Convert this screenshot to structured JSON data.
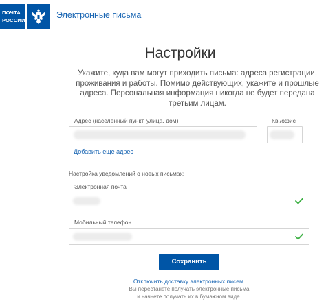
{
  "header": {
    "logo_line1": "ПОЧТА",
    "logo_line2": "РОССИИ",
    "link_label": "Электронные письма"
  },
  "main": {
    "title": "Настройки",
    "description": "Укажите, куда вам могут приходить письма: адреса регистрации, проживания и работы. Помимо действующих, укажите и прошлые адреса. Персональная информация никогда не будет передана третьим лицам."
  },
  "address": {
    "address_label": "Адрес (населенный пункт, улица, дом)",
    "apartment_label": "Кв./офис",
    "add_address_link": "Добавить еще адрес"
  },
  "notifications": {
    "section_label": "Настройка уведомлений о новых письмах:",
    "email_label": "Электронная почта",
    "phone_label": "Мобильный телефон"
  },
  "actions": {
    "save_label": "Сохранить",
    "disable_link": "Отключить доставку электронных писем.",
    "disable_note_line1": "Вы перестанете получать электронные письма",
    "disable_note_line2": "и начнете получать их в бумажном виде."
  },
  "colors": {
    "brand": "#0055a6",
    "link": "#1a66b3",
    "check": "#3cb043"
  },
  "icons": {
    "logo": "eagle-emblem-icon",
    "valid": "checkmark-icon"
  }
}
